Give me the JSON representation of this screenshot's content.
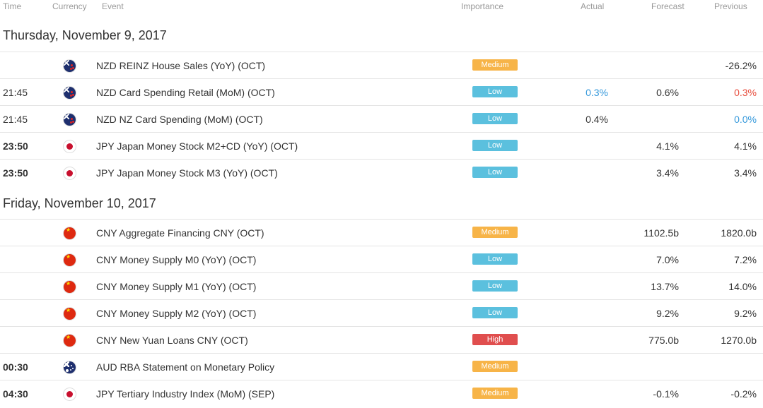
{
  "header": {
    "time": "Time",
    "currency": "Currency",
    "event": "Event",
    "importance": "Importance",
    "actual": "Actual",
    "forecast": "Forecast",
    "previous": "Previous"
  },
  "days": [
    {
      "label": "Thursday, November 9, 2017",
      "rows": [
        {
          "time": "",
          "bold": false,
          "flag": "nz-flag-icon",
          "event": "NZD REINZ House Sales (YoY) (OCT)",
          "importance": "Medium",
          "actual": "",
          "forecast": "",
          "previous": "-26.2%"
        },
        {
          "time": "21:45",
          "bold": false,
          "flag": "nz-flag-icon",
          "event": "NZD Card Spending Retail (MoM) (OCT)",
          "importance": "Low",
          "actual": "0.3%",
          "forecast": "0.6%",
          "previous": "0.3%"
        },
        {
          "time": "21:45",
          "bold": false,
          "flag": "nz-flag-icon",
          "event": "NZD NZ Card Spending (MoM) (OCT)",
          "importance": "Low",
          "actual": "0.4%",
          "forecast": "",
          "previous": "0.0%"
        },
        {
          "time": "23:50",
          "bold": true,
          "flag": "jp-flag-icon",
          "event": "JPY Japan Money Stock M2+CD (YoY) (OCT)",
          "importance": "Low",
          "actual": "",
          "forecast": "4.1%",
          "previous": "4.1%"
        },
        {
          "time": "23:50",
          "bold": true,
          "flag": "jp-flag-icon",
          "event": "JPY Japan Money Stock M3 (YoY) (OCT)",
          "importance": "Low",
          "actual": "",
          "forecast": "3.4%",
          "previous": "3.4%"
        }
      ]
    },
    {
      "label": "Friday, November 10, 2017",
      "rows": [
        {
          "time": "",
          "bold": false,
          "flag": "cn-flag-icon",
          "event": "CNY Aggregate Financing CNY (OCT)",
          "importance": "Medium",
          "actual": "",
          "forecast": "1102.5b",
          "previous": "1820.0b"
        },
        {
          "time": "",
          "bold": false,
          "flag": "cn-flag-icon",
          "event": "CNY Money Supply M0 (YoY) (OCT)",
          "importance": "Low",
          "actual": "",
          "forecast": "7.0%",
          "previous": "7.2%"
        },
        {
          "time": "",
          "bold": false,
          "flag": "cn-flag-icon",
          "event": "CNY Money Supply M1 (YoY) (OCT)",
          "importance": "Low",
          "actual": "",
          "forecast": "13.7%",
          "previous": "14.0%"
        },
        {
          "time": "",
          "bold": false,
          "flag": "cn-flag-icon",
          "event": "CNY Money Supply M2 (YoY) (OCT)",
          "importance": "Low",
          "actual": "",
          "forecast": "9.2%",
          "previous": "9.2%"
        },
        {
          "time": "",
          "bold": false,
          "flag": "cn-flag-icon",
          "event": "CNY New Yuan Loans CNY (OCT)",
          "importance": "High",
          "actual": "",
          "forecast": "775.0b",
          "previous": "1270.0b"
        },
        {
          "time": "00:30",
          "bold": true,
          "flag": "au-flag-icon",
          "event": "AUD RBA Statement on Monetary Policy",
          "importance": "Medium",
          "actual": "",
          "forecast": "",
          "previous": ""
        },
        {
          "time": "04:30",
          "bold": true,
          "flag": "jp-flag-icon",
          "event": "JPY Tertiary Industry Index (MoM) (SEP)",
          "importance": "Medium",
          "actual": "",
          "forecast": "-0.1%",
          "previous": "-0.2%"
        }
      ]
    }
  ],
  "colors": {
    "medium": "#f7b448",
    "low": "#5bc0de",
    "high": "#e04e4e",
    "better": "#3498db",
    "worse": "#e74c3c"
  },
  "value_colors": {
    "0.1.actual": "blue",
    "0.1.previous": "red",
    "0.2.previous": "blue"
  }
}
